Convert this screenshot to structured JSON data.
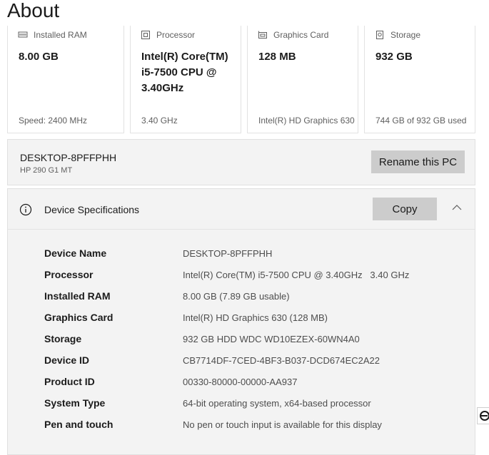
{
  "page": {
    "title": "About"
  },
  "cards": [
    {
      "icon": "ram-icon",
      "label": "Installed RAM",
      "value": "8.00 GB",
      "detail": "Speed: 2400 MHz"
    },
    {
      "icon": "processor-icon",
      "label": "Processor",
      "value": "Intel(R) Core(TM) i5-7500 CPU @ 3.40GHz",
      "detail": "3.40 GHz"
    },
    {
      "icon": "graphics-card-icon",
      "label": "Graphics Card",
      "value": "128 MB",
      "detail": "Intel(R) HD Graphics 630"
    },
    {
      "icon": "storage-icon",
      "label": "Storage",
      "value": "932 GB",
      "detail": "744 GB of 932 GB used"
    }
  ],
  "pc": {
    "name": "DESKTOP-8PFFPHH",
    "model": "HP 290 G1 MT",
    "rename_label": "Rename this PC"
  },
  "specs": {
    "title": "Device Specifications",
    "copy_label": "Copy",
    "rows": [
      {
        "label": "Device Name",
        "value": "DESKTOP-8PFFPHH"
      },
      {
        "label": "Processor",
        "value": "Intel(R) Core(TM) i5-7500 CPU @ 3.40GHz   3.40 GHz"
      },
      {
        "label": "Installed RAM",
        "value": "8.00 GB (7.89 GB usable)"
      },
      {
        "label": "Graphics Card",
        "value": "Intel(R) HD Graphics 630 (128 MB)"
      },
      {
        "label": "Storage",
        "value": "932 GB HDD WDC WD10EZEX-60WN4A0"
      },
      {
        "label": "Device ID",
        "value": "CB7714DF-7CED-4BF3-B037-DCD674EC2A22"
      },
      {
        "label": "Product ID",
        "value": "00330-80000-00000-AA937"
      },
      {
        "label": "System Type",
        "value": "64-bit operating system, x64-based processor"
      },
      {
        "label": "Pen and touch",
        "value": "No pen or touch input is available for this display"
      }
    ]
  },
  "colors": {
    "panel_bg": "#f3f3f3",
    "button_bg": "#cccccc",
    "text": "#1b1b1b",
    "muted": "#5f5f5f"
  }
}
